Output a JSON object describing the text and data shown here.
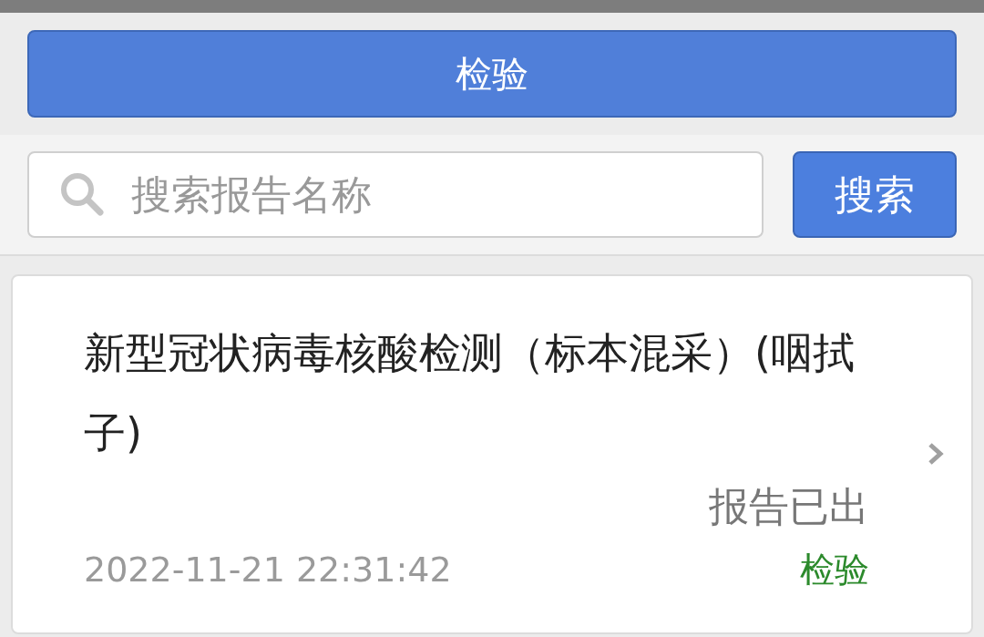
{
  "header": {
    "title": "检验"
  },
  "search": {
    "placeholder": "搜索报告名称",
    "button": "搜索"
  },
  "reports": [
    {
      "title": "新型冠状病毒核酸检测（标本混采）(咽拭子)",
      "status": "报告已出",
      "time": "2022-11-21 22:31:42",
      "category": "检验"
    }
  ]
}
